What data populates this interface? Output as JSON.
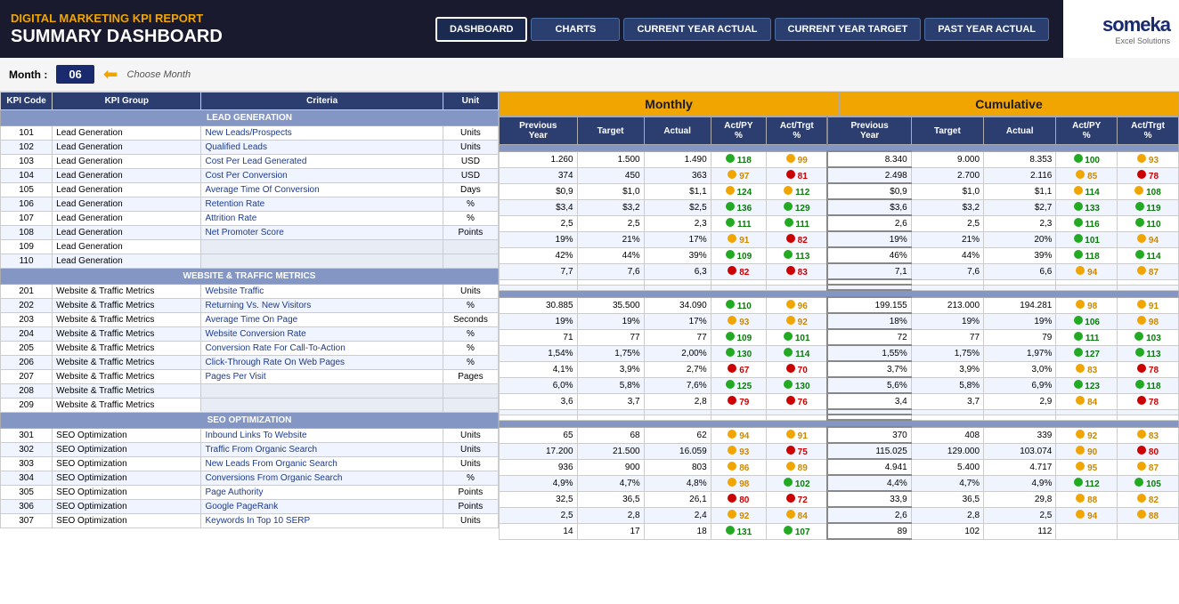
{
  "header": {
    "app_title": "DIGITAL MARKETING KPI REPORT",
    "page_title": "SUMMARY DASHBOARD",
    "nav": {
      "dashboard": "DASHBOARD",
      "charts": "CHARTS",
      "current_year_actual": "CURRENT YEAR ACTUAL",
      "current_year_target": "CURRENT YEAR TARGET",
      "past_year_actual": "PAST YEAR ACTUAL"
    },
    "logo": {
      "name": "someka",
      "sub": "Excel Solutions"
    }
  },
  "month_bar": {
    "label": "Month :",
    "value": "06",
    "choose": "Choose Month"
  },
  "kpi_columns": [
    "KPI Code",
    "KPI Group",
    "Criteria",
    "Unit"
  ],
  "monthly_columns": [
    "Previous Year",
    "Target",
    "Actual",
    "Act/PY %",
    "Act/Trgt %"
  ],
  "cumulative_columns": [
    "Previous Year",
    "Target",
    "Actual",
    "Act/PY %",
    "Act/Trgt %"
  ],
  "sections": [
    {
      "name": "LEAD GENERATION",
      "rows": [
        {
          "code": "101",
          "group": "Lead Generation",
          "criteria": "New Leads/Prospects",
          "unit": "Units",
          "m_py": "1.260",
          "m_tgt": "1.500",
          "m_act": "1.490",
          "m_apy": "118",
          "m_apy_c": "green",
          "m_apy_dot": "green",
          "m_atgt": "99",
          "m_atgt_c": "orange",
          "m_atgt_dot": "orange",
          "c_py": "8.340",
          "c_tgt": "9.000",
          "c_act": "8.353",
          "c_apy": "100",
          "c_apy_c": "green",
          "c_apy_dot": "green",
          "c_atgt": "93",
          "c_atgt_c": "orange",
          "c_atgt_dot": "orange"
        },
        {
          "code": "102",
          "group": "Lead Generation",
          "criteria": "Qualified Leads",
          "unit": "Units",
          "m_py": "374",
          "m_tgt": "450",
          "m_act": "363",
          "m_apy": "97",
          "m_apy_c": "orange",
          "m_apy_dot": "orange",
          "m_atgt": "81",
          "m_atgt_c": "red",
          "m_atgt_dot": "red",
          "c_py": "2.498",
          "c_tgt": "2.700",
          "c_act": "2.116",
          "c_apy": "85",
          "c_apy_c": "orange",
          "c_apy_dot": "orange",
          "c_atgt": "78",
          "c_atgt_c": "red",
          "c_atgt_dot": "red"
        },
        {
          "code": "103",
          "group": "Lead Generation",
          "criteria": "Cost Per Lead Generated",
          "unit": "USD",
          "m_py": "$0,9",
          "m_tgt": "$1,0",
          "m_act": "$1,1",
          "m_apy": "124",
          "m_apy_c": "green",
          "m_apy_dot": "orange",
          "m_atgt": "112",
          "m_atgt_c": "green",
          "m_atgt_dot": "orange",
          "c_py": "$0,9",
          "c_tgt": "$1,0",
          "c_act": "$1,1",
          "c_apy": "114",
          "c_apy_c": "green",
          "c_apy_dot": "orange",
          "c_atgt": "108",
          "c_atgt_c": "green",
          "c_atgt_dot": "orange"
        },
        {
          "code": "104",
          "group": "Lead Generation",
          "criteria": "Cost Per Conversion",
          "unit": "USD",
          "m_py": "$3,4",
          "m_tgt": "$3,2",
          "m_act": "$2,5",
          "m_apy": "136",
          "m_apy_c": "green",
          "m_apy_dot": "green",
          "m_atgt": "129",
          "m_atgt_c": "green",
          "m_atgt_dot": "green",
          "c_py": "$3,6",
          "c_tgt": "$3,2",
          "c_act": "$2,7",
          "c_apy": "133",
          "c_apy_c": "green",
          "c_apy_dot": "green",
          "c_atgt": "119",
          "c_atgt_c": "green",
          "c_atgt_dot": "green"
        },
        {
          "code": "105",
          "group": "Lead Generation",
          "criteria": "Average Time Of Conversion",
          "unit": "Days",
          "m_py": "2,5",
          "m_tgt": "2,5",
          "m_act": "2,3",
          "m_apy": "111",
          "m_apy_c": "green",
          "m_apy_dot": "green",
          "m_atgt": "111",
          "m_atgt_c": "green",
          "m_atgt_dot": "green",
          "c_py": "2,6",
          "c_tgt": "2,5",
          "c_act": "2,3",
          "c_apy": "116",
          "c_apy_c": "green",
          "c_apy_dot": "green",
          "c_atgt": "110",
          "c_atgt_c": "green",
          "c_atgt_dot": "green"
        },
        {
          "code": "106",
          "group": "Lead Generation",
          "criteria": "Retention Rate",
          "unit": "%",
          "m_py": "19%",
          "m_tgt": "21%",
          "m_act": "17%",
          "m_apy": "91",
          "m_apy_c": "orange",
          "m_apy_dot": "orange",
          "m_atgt": "82",
          "m_atgt_c": "red",
          "m_atgt_dot": "red",
          "c_py": "19%",
          "c_tgt": "21%",
          "c_act": "20%",
          "c_apy": "101",
          "c_apy_c": "green",
          "c_apy_dot": "green",
          "c_atgt": "94",
          "c_atgt_c": "orange",
          "c_atgt_dot": "orange"
        },
        {
          "code": "107",
          "group": "Lead Generation",
          "criteria": "Attrition Rate",
          "unit": "%",
          "m_py": "42%",
          "m_tgt": "44%",
          "m_act": "39%",
          "m_apy": "109",
          "m_apy_c": "green",
          "m_apy_dot": "green",
          "m_atgt": "113",
          "m_atgt_c": "green",
          "m_atgt_dot": "green",
          "c_py": "46%",
          "c_tgt": "44%",
          "c_act": "39%",
          "c_apy": "118",
          "c_apy_c": "green",
          "c_apy_dot": "green",
          "c_atgt": "114",
          "c_atgt_c": "green",
          "c_atgt_dot": "green"
        },
        {
          "code": "108",
          "group": "Lead Generation",
          "criteria": "Net Promoter Score",
          "unit": "Points",
          "m_py": "7,7",
          "m_tgt": "7,6",
          "m_act": "6,3",
          "m_apy": "82",
          "m_apy_c": "red",
          "m_apy_dot": "red",
          "m_atgt": "83",
          "m_atgt_c": "red",
          "m_atgt_dot": "red",
          "c_py": "7,1",
          "c_tgt": "7,6",
          "c_act": "6,6",
          "c_apy": "94",
          "c_apy_c": "orange",
          "c_apy_dot": "orange",
          "c_atgt": "87",
          "c_atgt_c": "orange",
          "c_atgt_dot": "orange"
        },
        {
          "code": "109",
          "group": "Lead Generation",
          "criteria": "",
          "unit": "",
          "m_py": "",
          "m_tgt": "",
          "m_act": "",
          "m_apy": "",
          "m_atgt": "",
          "c_py": "",
          "c_tgt": "",
          "c_act": "",
          "c_apy": "",
          "c_atgt": ""
        },
        {
          "code": "110",
          "group": "Lead Generation",
          "criteria": "",
          "unit": "",
          "m_py": "",
          "m_tgt": "",
          "m_act": "",
          "m_apy": "",
          "m_atgt": "",
          "c_py": "",
          "c_tgt": "",
          "c_act": "",
          "c_apy": "",
          "c_atgt": ""
        }
      ]
    },
    {
      "name": "WEBSITE & TRAFFIC METRICS",
      "rows": [
        {
          "code": "201",
          "group": "Website & Traffic Metrics",
          "criteria": "Website Traffic",
          "unit": "Units",
          "m_py": "30.885",
          "m_tgt": "35.500",
          "m_act": "34.090",
          "m_apy": "110",
          "m_apy_c": "green",
          "m_apy_dot": "green",
          "m_atgt": "96",
          "m_atgt_c": "orange",
          "m_atgt_dot": "orange",
          "c_py": "199.155",
          "c_tgt": "213.000",
          "c_act": "194.281",
          "c_apy": "98",
          "c_apy_c": "orange",
          "c_apy_dot": "orange",
          "c_atgt": "91",
          "c_atgt_c": "orange",
          "c_atgt_dot": "orange"
        },
        {
          "code": "202",
          "group": "Website & Traffic Metrics",
          "criteria": "Returning Vs. New Visitors",
          "unit": "%",
          "m_py": "19%",
          "m_tgt": "19%",
          "m_act": "17%",
          "m_apy": "93",
          "m_apy_c": "orange",
          "m_apy_dot": "orange",
          "m_atgt": "92",
          "m_atgt_c": "orange",
          "m_atgt_dot": "orange",
          "c_py": "18%",
          "c_tgt": "19%",
          "c_act": "19%",
          "c_apy": "106",
          "c_apy_c": "green",
          "c_apy_dot": "green",
          "c_atgt": "98",
          "c_atgt_c": "orange",
          "c_atgt_dot": "orange"
        },
        {
          "code": "203",
          "group": "Website & Traffic Metrics",
          "criteria": "Average Time On Page",
          "unit": "Seconds",
          "m_py": "71",
          "m_tgt": "77",
          "m_act": "77",
          "m_apy": "109",
          "m_apy_c": "green",
          "m_apy_dot": "green",
          "m_atgt": "101",
          "m_atgt_c": "green",
          "m_atgt_dot": "green",
          "c_py": "72",
          "c_tgt": "77",
          "c_act": "79",
          "c_apy": "111",
          "c_apy_c": "green",
          "c_apy_dot": "green",
          "c_atgt": "103",
          "c_atgt_c": "green",
          "c_atgt_dot": "green"
        },
        {
          "code": "204",
          "group": "Website & Traffic Metrics",
          "criteria": "Website Conversion Rate",
          "unit": "%",
          "m_py": "1,54%",
          "m_tgt": "1,75%",
          "m_act": "2,00%",
          "m_apy": "130",
          "m_apy_c": "green",
          "m_apy_dot": "green",
          "m_atgt": "114",
          "m_atgt_c": "green",
          "m_atgt_dot": "green",
          "c_py": "1,55%",
          "c_tgt": "1,75%",
          "c_act": "1,97%",
          "c_apy": "127",
          "c_apy_c": "green",
          "c_apy_dot": "green",
          "c_atgt": "113",
          "c_atgt_c": "green",
          "c_atgt_dot": "green"
        },
        {
          "code": "205",
          "group": "Website & Traffic Metrics",
          "criteria": "Conversion Rate For Call-To-Action",
          "unit": "%",
          "m_py": "4,1%",
          "m_tgt": "3,9%",
          "m_act": "2,7%",
          "m_apy": "67",
          "m_apy_c": "red",
          "m_apy_dot": "red",
          "m_atgt": "70",
          "m_atgt_c": "red",
          "m_atgt_dot": "red",
          "c_py": "3,7%",
          "c_tgt": "3,9%",
          "c_act": "3,0%",
          "c_apy": "83",
          "c_apy_c": "orange",
          "c_apy_dot": "orange",
          "c_atgt": "78",
          "c_atgt_c": "red",
          "c_atgt_dot": "red"
        },
        {
          "code": "206",
          "group": "Website & Traffic Metrics",
          "criteria": "Click-Through Rate On Web Pages",
          "unit": "%",
          "m_py": "6,0%",
          "m_tgt": "5,8%",
          "m_act": "7,6%",
          "m_apy": "125",
          "m_apy_c": "green",
          "m_apy_dot": "green",
          "m_atgt": "130",
          "m_atgt_c": "green",
          "m_atgt_dot": "green",
          "c_py": "5,6%",
          "c_tgt": "5,8%",
          "c_act": "6,9%",
          "c_apy": "123",
          "c_apy_c": "green",
          "c_apy_dot": "green",
          "c_atgt": "118",
          "c_atgt_c": "green",
          "c_atgt_dot": "green"
        },
        {
          "code": "207",
          "group": "Website & Traffic Metrics",
          "criteria": "Pages Per Visit",
          "unit": "Pages",
          "m_py": "3,6",
          "m_tgt": "3,7",
          "m_act": "2,8",
          "m_apy": "79",
          "m_apy_c": "red",
          "m_apy_dot": "red",
          "m_atgt": "76",
          "m_atgt_c": "red",
          "m_atgt_dot": "red",
          "c_py": "3,4",
          "c_tgt": "3,7",
          "c_act": "2,9",
          "c_apy": "84",
          "c_apy_c": "orange",
          "c_apy_dot": "orange",
          "c_atgt": "78",
          "c_atgt_c": "red",
          "c_atgt_dot": "red"
        },
        {
          "code": "208",
          "group": "Website & Traffic Metrics",
          "criteria": "",
          "unit": "",
          "m_py": "",
          "m_tgt": "",
          "m_act": "",
          "m_apy": "",
          "m_atgt": "",
          "c_py": "",
          "c_tgt": "",
          "c_act": "",
          "c_apy": "",
          "c_atgt": ""
        },
        {
          "code": "209",
          "group": "Website & Traffic Metrics",
          "criteria": "",
          "unit": "",
          "m_py": "",
          "m_tgt": "",
          "m_act": "",
          "m_apy": "",
          "m_atgt": "",
          "c_py": "",
          "c_tgt": "",
          "c_act": "",
          "c_apy": "",
          "c_atgt": ""
        }
      ]
    },
    {
      "name": "SEO OPTIMIZATION",
      "rows": [
        {
          "code": "301",
          "group": "SEO Optimization",
          "criteria": "Inbound Links To Website",
          "unit": "Units",
          "m_py": "65",
          "m_tgt": "68",
          "m_act": "62",
          "m_apy": "94",
          "m_apy_c": "orange",
          "m_apy_dot": "orange",
          "m_atgt": "91",
          "m_atgt_c": "orange",
          "m_atgt_dot": "orange",
          "c_py": "370",
          "c_tgt": "408",
          "c_act": "339",
          "c_apy": "92",
          "c_apy_c": "orange",
          "c_apy_dot": "orange",
          "c_atgt": "83",
          "c_atgt_c": "orange",
          "c_atgt_dot": "orange"
        },
        {
          "code": "302",
          "group": "SEO Optimization",
          "criteria": "Traffic From Organic Search",
          "unit": "Units",
          "m_py": "17.200",
          "m_tgt": "21.500",
          "m_act": "16.059",
          "m_apy": "93",
          "m_apy_c": "orange",
          "m_apy_dot": "orange",
          "m_atgt": "75",
          "m_atgt_c": "red",
          "m_atgt_dot": "red",
          "c_py": "115.025",
          "c_tgt": "129.000",
          "c_act": "103.074",
          "c_apy": "90",
          "c_apy_c": "orange",
          "c_apy_dot": "orange",
          "c_atgt": "80",
          "c_atgt_c": "red",
          "c_atgt_dot": "red"
        },
        {
          "code": "303",
          "group": "SEO Optimization",
          "criteria": "New Leads From Organic Search",
          "unit": "Units",
          "m_py": "936",
          "m_tgt": "900",
          "m_act": "803",
          "m_apy": "86",
          "m_apy_c": "orange",
          "m_apy_dot": "orange",
          "m_atgt": "89",
          "m_atgt_c": "orange",
          "m_atgt_dot": "orange",
          "c_py": "4.941",
          "c_tgt": "5.400",
          "c_act": "4.717",
          "c_apy": "95",
          "c_apy_c": "orange",
          "c_apy_dot": "orange",
          "c_atgt": "87",
          "c_atgt_c": "orange",
          "c_atgt_dot": "orange"
        },
        {
          "code": "304",
          "group": "SEO Optimization",
          "criteria": "Conversions From Organic Search",
          "unit": "%",
          "m_py": "4,9%",
          "m_tgt": "4,7%",
          "m_act": "4,8%",
          "m_apy": "98",
          "m_apy_c": "orange",
          "m_apy_dot": "orange",
          "m_atgt": "102",
          "m_atgt_c": "green",
          "m_atgt_dot": "green",
          "c_py": "4,4%",
          "c_tgt": "4,7%",
          "c_act": "4,9%",
          "c_apy": "112",
          "c_apy_c": "green",
          "c_apy_dot": "green",
          "c_atgt": "105",
          "c_atgt_c": "green",
          "c_atgt_dot": "green"
        },
        {
          "code": "305",
          "group": "SEO Optimization",
          "criteria": "Page Authority",
          "unit": "Points",
          "m_py": "32,5",
          "m_tgt": "36,5",
          "m_act": "26,1",
          "m_apy": "80",
          "m_apy_c": "red",
          "m_apy_dot": "red",
          "m_atgt": "72",
          "m_atgt_c": "red",
          "m_atgt_dot": "red",
          "c_py": "33,9",
          "c_tgt": "36,5",
          "c_act": "29,8",
          "c_apy": "88",
          "c_apy_c": "orange",
          "c_apy_dot": "orange",
          "c_atgt": "82",
          "c_atgt_c": "orange",
          "c_atgt_dot": "orange"
        },
        {
          "code": "306",
          "group": "SEO Optimization",
          "criteria": "Google PageRank",
          "unit": "Points",
          "m_py": "2,5",
          "m_tgt": "2,8",
          "m_act": "2,4",
          "m_apy": "92",
          "m_apy_c": "orange",
          "m_apy_dot": "orange",
          "m_atgt": "84",
          "m_atgt_c": "orange",
          "m_atgt_dot": "orange",
          "c_py": "2,6",
          "c_tgt": "2,8",
          "c_act": "2,5",
          "c_apy": "94",
          "c_apy_c": "orange",
          "c_apy_dot": "orange",
          "c_atgt": "88",
          "c_atgt_c": "orange",
          "c_atgt_dot": "orange"
        },
        {
          "code": "307",
          "group": "SEO Optimization",
          "criteria": "Keywords In Top 10 SERP",
          "unit": "Units",
          "m_py": "14",
          "m_tgt": "17",
          "m_act": "18",
          "m_apy": "131",
          "m_apy_c": "green",
          "m_apy_dot": "green",
          "m_atgt": "107",
          "m_atgt_c": "green",
          "m_atgt_dot": "green",
          "c_py": "89",
          "c_tgt": "102",
          "c_act": "112",
          "c_apy": "",
          "c_apy_c": "",
          "c_apy_dot": "",
          "c_atgt": "",
          "c_atgt_c": "",
          "c_atgt_dot": ""
        }
      ]
    }
  ]
}
